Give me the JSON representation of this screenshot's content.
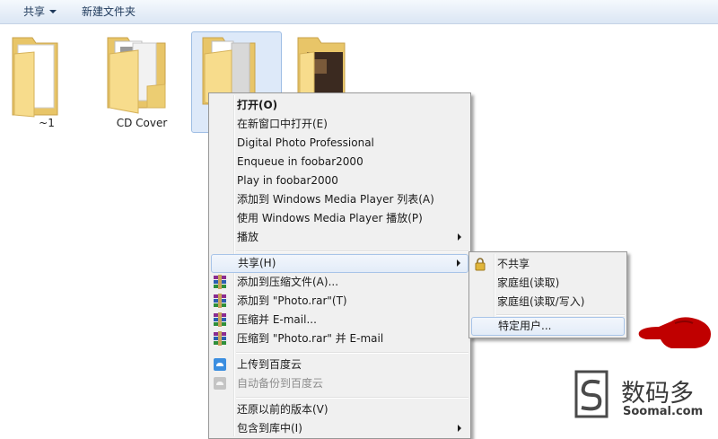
{
  "toolbar": {
    "share_label": "共享",
    "new_folder_label": "新建文件夹"
  },
  "folders": [
    {
      "label": "~1"
    },
    {
      "label": "CD Cover"
    },
    {
      "label": ""
    },
    {
      "label": ""
    }
  ],
  "context_menu": {
    "items": [
      {
        "label": "打开(O)"
      },
      {
        "label": "在新窗口中打开(E)"
      },
      {
        "label": "Digital Photo Professional"
      },
      {
        "label": "Enqueue in foobar2000"
      },
      {
        "label": "Play in foobar2000"
      },
      {
        "label": "添加到 Windows Media Player 列表(A)"
      },
      {
        "label": "使用 Windows Media Player 播放(P)"
      },
      {
        "label": "播放"
      },
      {
        "label": "共享(H)"
      },
      {
        "label": "添加到压缩文件(A)..."
      },
      {
        "label": "添加到 \"Photo.rar\"(T)"
      },
      {
        "label": "压缩并 E-mail..."
      },
      {
        "label": "压缩到 \"Photo.rar\" 并 E-mail"
      },
      {
        "label": "上传到百度云"
      },
      {
        "label": "自动备份到百度云"
      },
      {
        "label": "还原以前的版本(V)"
      },
      {
        "label": "包含到库中(I)"
      }
    ]
  },
  "share_submenu": {
    "items": [
      {
        "label": "不共享",
        "icon": "lock-icon"
      },
      {
        "label": "家庭组(读取)"
      },
      {
        "label": "家庭组(读取/写入)"
      },
      {
        "label": "特定用户..."
      }
    ]
  },
  "watermark": {
    "brand": "数码多",
    "site": "Soomal.com"
  },
  "colors": {
    "toolbar_text": "#1e395b",
    "selection": "#dde9f9",
    "menu_bg": "#f0f0f0",
    "pointer_hand": "#c00000"
  }
}
